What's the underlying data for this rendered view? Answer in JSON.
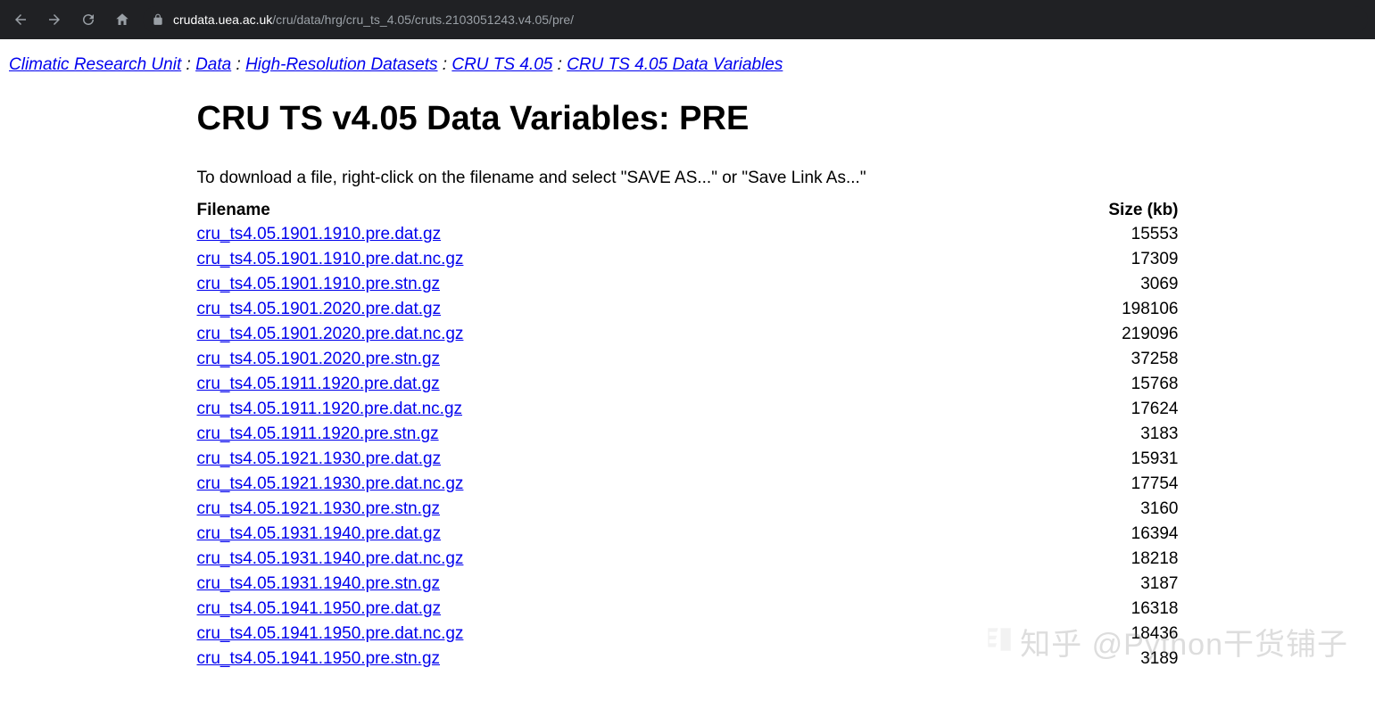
{
  "browser": {
    "url_host": "crudata.uea.ac.uk",
    "url_path": "/cru/data/hrg/cru_ts_4.05/cruts.2103051243.v4.05/pre/"
  },
  "breadcrumb": {
    "items": [
      {
        "label": "Climatic Research Unit"
      },
      {
        "label": "Data"
      },
      {
        "label": "High-Resolution Datasets"
      },
      {
        "label": "CRU TS 4.05"
      },
      {
        "label": "CRU TS 4.05 Data Variables"
      }
    ],
    "separator": " : "
  },
  "heading": "CRU TS v4.05 Data Variables: PRE",
  "instruction": "To download a file, right-click on the filename and select \"SAVE AS...\" or \"Save Link As...\"",
  "table": {
    "headers": {
      "filename": "Filename",
      "size": "Size (kb)"
    },
    "rows": [
      {
        "filename": "cru_ts4.05.1901.1910.pre.dat.gz",
        "size": "15553"
      },
      {
        "filename": "cru_ts4.05.1901.1910.pre.dat.nc.gz",
        "size": "17309"
      },
      {
        "filename": "cru_ts4.05.1901.1910.pre.stn.gz",
        "size": "3069"
      },
      {
        "filename": "cru_ts4.05.1901.2020.pre.dat.gz",
        "size": "198106"
      },
      {
        "filename": "cru_ts4.05.1901.2020.pre.dat.nc.gz",
        "size": "219096"
      },
      {
        "filename": "cru_ts4.05.1901.2020.pre.stn.gz",
        "size": "37258"
      },
      {
        "filename": "cru_ts4.05.1911.1920.pre.dat.gz",
        "size": "15768"
      },
      {
        "filename": "cru_ts4.05.1911.1920.pre.dat.nc.gz",
        "size": "17624"
      },
      {
        "filename": "cru_ts4.05.1911.1920.pre.stn.gz",
        "size": "3183"
      },
      {
        "filename": "cru_ts4.05.1921.1930.pre.dat.gz",
        "size": "15931"
      },
      {
        "filename": "cru_ts4.05.1921.1930.pre.dat.nc.gz",
        "size": "17754"
      },
      {
        "filename": "cru_ts4.05.1921.1930.pre.stn.gz",
        "size": "3160"
      },
      {
        "filename": "cru_ts4.05.1931.1940.pre.dat.gz",
        "size": "16394"
      },
      {
        "filename": "cru_ts4.05.1931.1940.pre.dat.nc.gz",
        "size": "18218"
      },
      {
        "filename": "cru_ts4.05.1931.1940.pre.stn.gz",
        "size": "3187"
      },
      {
        "filename": "cru_ts4.05.1941.1950.pre.dat.gz",
        "size": "16318"
      },
      {
        "filename": "cru_ts4.05.1941.1950.pre.dat.nc.gz",
        "size": "18436"
      },
      {
        "filename": "cru_ts4.05.1941.1950.pre.stn.gz",
        "size": "3189"
      }
    ]
  },
  "watermark": "知乎 @Python干货铺子"
}
